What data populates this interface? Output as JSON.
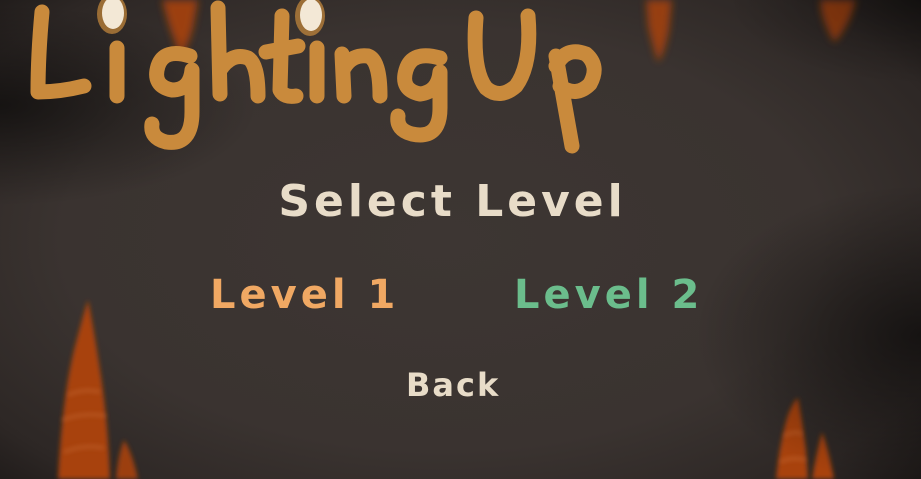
{
  "game": {
    "title": "Lighting Up"
  },
  "menu": {
    "heading": "Select Level",
    "levels": [
      {
        "label": "Level 1",
        "color": "#f0a863"
      },
      {
        "label": "Level 2",
        "color": "#6bbd8c"
      }
    ],
    "back_label": "Back"
  },
  "colors": {
    "background": "#3a3330",
    "title": "#c98a3c",
    "text": "#e8dcc8",
    "flame": "#a84210"
  },
  "icons": [
    "candle-drip-icon",
    "candle-flame-icon"
  ]
}
